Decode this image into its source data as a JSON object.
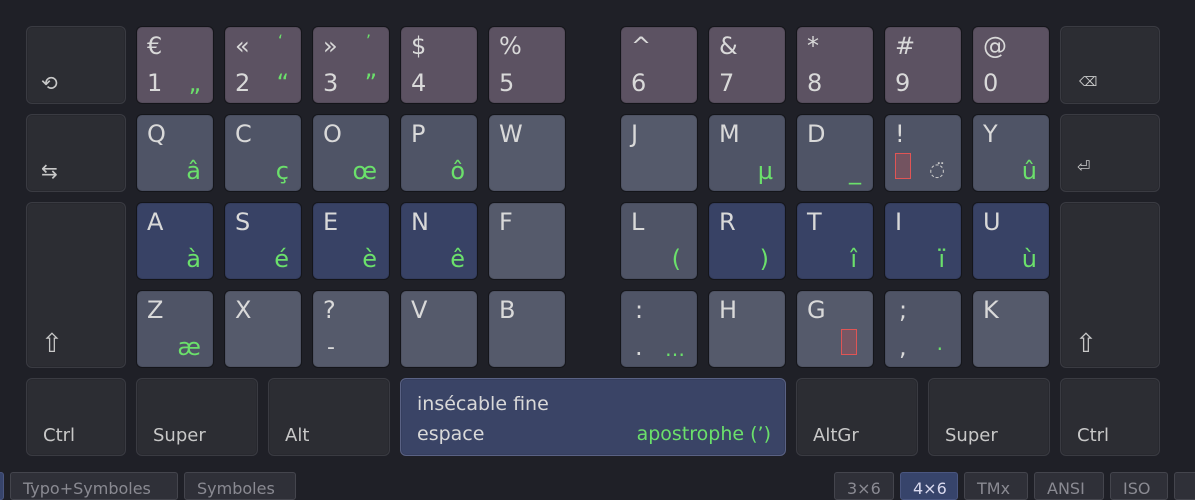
{
  "colors": {
    "background": "#1f2027",
    "alt_glyph": "#6be06b",
    "dead_key": "#e05555",
    "home_row": "#384265",
    "number_row": "#5c5262",
    "active_tab": "#37446b"
  },
  "keyboard": {
    "left_mods": {
      "undo_icon": "⟲",
      "tab_icon": "⇆",
      "shift_icon": "⇧",
      "ctrl": "Ctrl",
      "super": "Super",
      "alt": "Alt"
    },
    "right_mods": {
      "backspace_icon": "⌫",
      "enter_icon": "⏎",
      "shift_icon": "⇧",
      "altgr": "AltGr",
      "super": "Super",
      "ctrl": "Ctrl"
    },
    "numbers": [
      {
        "shift": "€",
        "base": "1",
        "shift_alt": "",
        "alt": "„"
      },
      {
        "shift": "«",
        "base": "2",
        "shift_alt": "‘",
        "alt": "“"
      },
      {
        "shift": "»",
        "base": "3",
        "shift_alt": "’",
        "alt": "”"
      },
      {
        "shift": "$",
        "base": "4",
        "shift_alt": "",
        "alt": ""
      },
      {
        "shift": "%",
        "base": "5",
        "shift_alt": "",
        "alt": ""
      },
      {
        "shift": "^",
        "base": "6",
        "shift_alt": "",
        "alt": ""
      },
      {
        "shift": "&",
        "base": "7",
        "shift_alt": "",
        "alt": ""
      },
      {
        "shift": "*",
        "base": "8",
        "shift_alt": "",
        "alt": ""
      },
      {
        "shift": "#",
        "base": "9",
        "shift_alt": "",
        "alt": ""
      },
      {
        "shift": "@",
        "base": "0",
        "shift_alt": "",
        "alt": ""
      }
    ],
    "top": [
      {
        "shift": "Q",
        "alt": "â"
      },
      {
        "shift": "C",
        "alt": "ç"
      },
      {
        "shift": "O",
        "alt": "œ"
      },
      {
        "shift": "P",
        "alt": "ô"
      },
      {
        "shift": "W",
        "alt": ""
      },
      {
        "shift": "J",
        "alt": ""
      },
      {
        "shift": "M",
        "alt": "µ"
      },
      {
        "shift": "D",
        "alt": "_"
      },
      {
        "shift": "!",
        "alt": ""
      },
      {
        "shift": "Y",
        "alt": "û"
      }
    ],
    "top_extra": {
      "ring": "◌̈"
    },
    "home": [
      {
        "shift": "A",
        "alt": "à"
      },
      {
        "shift": "S",
        "alt": "é"
      },
      {
        "shift": "E",
        "alt": "è"
      },
      {
        "shift": "N",
        "alt": "ê"
      },
      {
        "shift": "F",
        "alt": ""
      },
      {
        "shift": "L",
        "alt": "("
      },
      {
        "shift": "R",
        "alt": ")"
      },
      {
        "shift": "T",
        "alt": "î"
      },
      {
        "shift": "I",
        "alt": "ï"
      },
      {
        "shift": "U",
        "alt": "ù"
      }
    ],
    "bottom": [
      {
        "shift": "Z",
        "base": "",
        "alt": "æ"
      },
      {
        "shift": "X",
        "base": "",
        "alt": ""
      },
      {
        "shift": "?",
        "base": "-",
        "alt": ""
      },
      {
        "shift": "V",
        "base": "",
        "alt": ""
      },
      {
        "shift": "B",
        "base": "",
        "alt": ""
      },
      {
        "shift": ":",
        "base": ".",
        "alt": "…"
      },
      {
        "shift": "H",
        "base": "",
        "alt": ""
      },
      {
        "shift": "G",
        "base": "",
        "alt": ""
      },
      {
        "shift": ";",
        "base": ",",
        "alt": "·"
      },
      {
        "shift": "K",
        "base": "",
        "alt": ""
      }
    ],
    "space": {
      "top": "insécable fine",
      "bottom": "espace",
      "alt": "apostrophe (’)"
    }
  },
  "tabs_left": [
    "Typo+Symboles",
    "Symboles"
  ],
  "tabs_right": [
    "3×6",
    "4×6",
    "TMx",
    "ANSI",
    "ISO"
  ],
  "active_tab": "4×6"
}
